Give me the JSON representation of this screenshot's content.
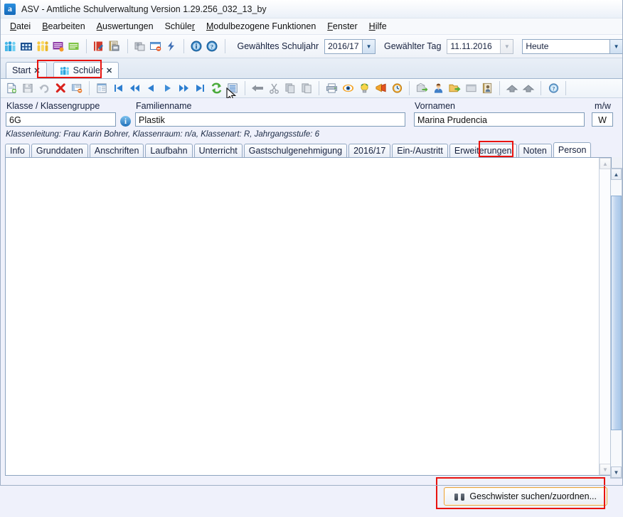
{
  "window": {
    "title": "ASV - Amtliche Schulverwaltung Version 1.29.256_032_13_by",
    "app_icon": "a"
  },
  "menubar": {
    "items": [
      {
        "label": "Datei",
        "accel": "D"
      },
      {
        "label": "Bearbeiten",
        "accel": "B"
      },
      {
        "label": "Auswertungen",
        "accel": "A"
      },
      {
        "label": "Schüler",
        "accel": "r"
      },
      {
        "label": "Modulbezogene Funktionen",
        "accel": "M"
      },
      {
        "label": "Fenster",
        "accel": "F"
      },
      {
        "label": "Hilfe",
        "accel": "H"
      }
    ]
  },
  "toolbar_main": {
    "icons": [
      "students-group-icon",
      "school-building-icon",
      "persons-icon",
      "report-purple-icon",
      "report-green-icon",
      "book-edit-icon",
      "print-list-icon",
      "module-gray-icon",
      "window-block-icon",
      "lightning-icon",
      "info-icon",
      "help-icon"
    ],
    "schoolyear_label": "Gewähltes Schuljahr",
    "schoolyear_value": "2016/17",
    "day_label": "Gewählter Tag",
    "day_value": "11.11.2016",
    "period_value": "Heute"
  },
  "doc_tabs": {
    "items": [
      {
        "label": "Start",
        "icon": "none",
        "active": false,
        "closable": true
      },
      {
        "label": "Schüler",
        "icon": "students-group-icon",
        "active": true,
        "closable": true
      }
    ],
    "highlighted": "Schüler"
  },
  "toolbar_record": {
    "icons": [
      "new-record-icon",
      "save-icon",
      "undo-revert-icon",
      "delete-record-icon",
      "remove-entry-icon",
      "list-view-icon",
      "first-record-icon",
      "fast-back-icon",
      "prev-record-icon",
      "next-record-icon",
      "fast-forward-icon",
      "last-record-icon",
      "refresh-icon",
      "report-lines-icon",
      "back-arrow-icon",
      "cut-icon",
      "copy-icon",
      "paste-icon",
      "print-icon",
      "preview-icon",
      "hint-bulb-icon",
      "megaphone-icon",
      "clock-icon",
      "export-icon",
      "user-icon",
      "folder-export-icon",
      "window-gray-icon",
      "address-book-icon",
      "merge-up-icon",
      "merge-up2-icon",
      "help-circle-icon"
    ]
  },
  "form": {
    "class_label": "Klasse / Klassengruppe",
    "class_value": "6G",
    "lastname_label": "Familienname",
    "lastname_value": "Plastik",
    "firstname_label": "Vornamen",
    "firstname_value": "Marina Prudencia",
    "gender_label": "m/w",
    "gender_value": "W",
    "class_info": "Klassenleitung: Frau Karin Bohrer, Klassenraum: n/a, Klassenart: R, Jahrgangsstufe: 6"
  },
  "inner_tabs": {
    "items": [
      {
        "label": "Info",
        "active": false
      },
      {
        "label": "Grunddaten",
        "active": false
      },
      {
        "label": "Anschriften",
        "active": false
      },
      {
        "label": "Laufbahn",
        "active": false
      },
      {
        "label": "Unterricht",
        "active": false
      },
      {
        "label": "Gastschulgenehmigung",
        "active": false
      },
      {
        "label": "2016/17",
        "active": false
      },
      {
        "label": "Ein-/Austritt",
        "active": false
      },
      {
        "label": "Erweiterungen",
        "active": false
      },
      {
        "label": "Noten",
        "active": false
      },
      {
        "label": "Person",
        "active": true
      }
    ],
    "highlighted": "Person"
  },
  "bottom": {
    "sibling_button_label": "Geschwister suchen/zuordnen...",
    "sibling_button_icon": "binoculars-icon",
    "highlighted": true
  },
  "colors": {
    "highlight_red": "#e8130f",
    "button_hover_orange": "#e8a33d",
    "form_background": "#eff1fb",
    "accent_blue": "#1d6fb8"
  },
  "scrollbars": {
    "inner_up": "▲",
    "inner_down": "▼",
    "outer_up": "▲",
    "outer_down": "▼"
  }
}
